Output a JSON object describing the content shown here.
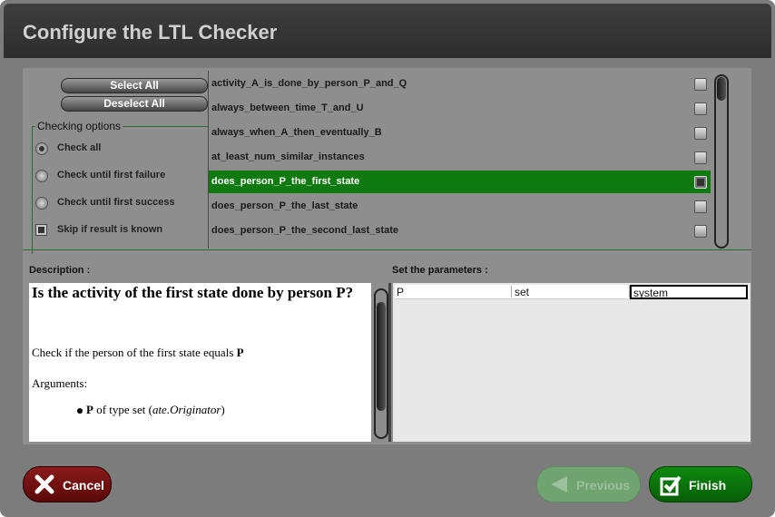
{
  "window": {
    "title": "Configure the LTL Checker"
  },
  "left": {
    "select_all": "Select All",
    "deselect_all": "Deselect All",
    "legend": "Checking options",
    "options": [
      {
        "label": "Check all",
        "type": "radio",
        "checked": true
      },
      {
        "label": "Check until first failure",
        "type": "radio",
        "checked": false
      },
      {
        "label": "Check until first success",
        "type": "radio",
        "checked": false
      },
      {
        "label": "Skip if result is known",
        "type": "checkbox",
        "checked": true
      }
    ]
  },
  "formulas": {
    "selected_index": 4,
    "items": [
      "activity_A_is_done_by_person_P_and_Q",
      "always_between_time_T_and_U",
      "always_when_A_then_eventually_B",
      "at_least_num_similar_instances",
      "does_person_P_the_first_state",
      "does_person_P_the_last_state",
      "does_person_P_the_second_last_state"
    ]
  },
  "description": {
    "label": "Description :",
    "heading": "Is the activity of the first state done by person P?",
    "check_text": "Check if the person of the first state equals ",
    "check_bold": "P",
    "arguments_label": "Arguments:",
    "arg_name": "P",
    "arg_type_text": " of type set (",
    "arg_type_italic": "ate.Originator",
    "arg_close": ")"
  },
  "parameters": {
    "label": "Set the parameters :",
    "row": {
      "name": "P",
      "type": "set",
      "value": "system"
    }
  },
  "buttons": {
    "cancel": "Cancel",
    "previous": "Previous",
    "finish": "Finish"
  },
  "colors": {
    "selection_green": "#0f7a0f",
    "cancel_red": "#7a1010",
    "finish_green": "#0c7d0c"
  }
}
